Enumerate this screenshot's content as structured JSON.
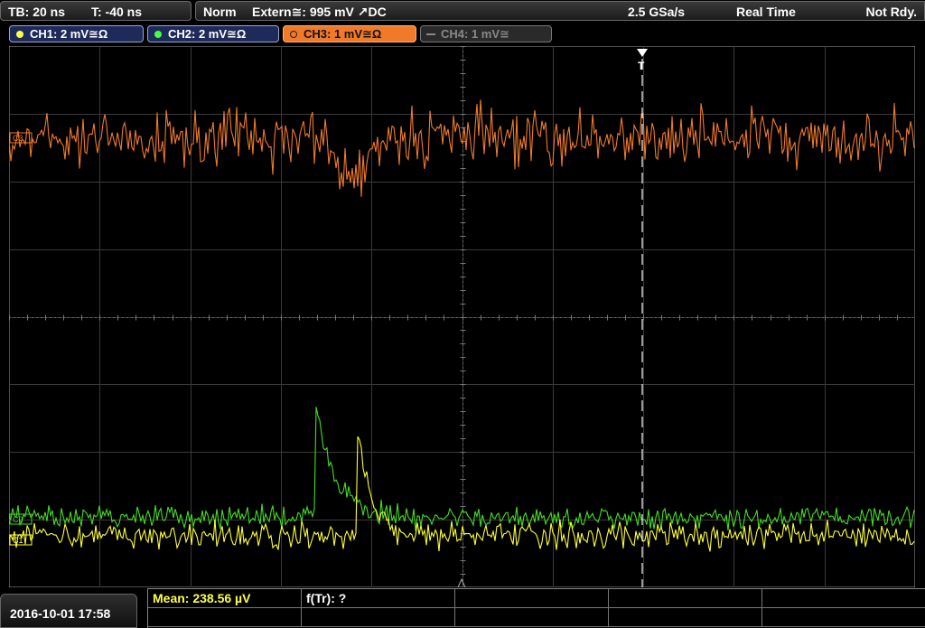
{
  "timebase": {
    "tb": "TB: 20 ns",
    "trigger_time": "T: -40 ns"
  },
  "status": {
    "mode": "Norm",
    "trigger": "Extern≅: 995 mV ↗DC",
    "sample_rate": "2.5 GSa/s",
    "acquisition": "Real Time",
    "ready": "Not Rdy."
  },
  "channels": [
    {
      "label": "CH1: 2 mV≅Ω",
      "color": "#ffff44",
      "active": true
    },
    {
      "label": "CH2: 2 mV≅Ω",
      "color": "#44ff44",
      "active": true
    },
    {
      "label": "CH3: 1 mV≅Ω",
      "color": "#f07a2a",
      "active": true,
      "selected": true
    },
    {
      "label": "CH4: 1 mV≅",
      "color": "#888888",
      "active": false
    }
  ],
  "markers": {
    "ch3": "C3",
    "ch2": "C2",
    "ch1": "C1",
    "trigger": "T"
  },
  "measurements": {
    "mean": "Mean: 238.56 µV",
    "ftr": "f(Tr): ?"
  },
  "datetime": "2016-10-01 17:58"
}
